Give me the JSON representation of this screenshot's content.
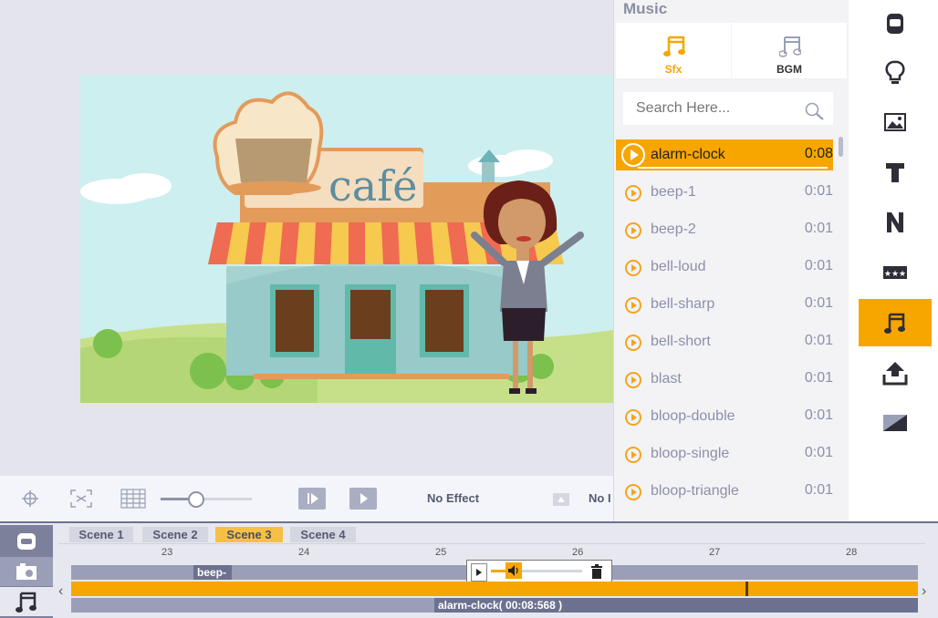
{
  "music_panel": {
    "title": "Music",
    "tabs": [
      {
        "label": "Sfx",
        "icon": "music-note-icon",
        "active": true
      },
      {
        "label": "BGM",
        "icon": "music-note-icon",
        "active": false
      }
    ],
    "search_placeholder": "Search Here...",
    "tracks": [
      {
        "name": "alarm-clock",
        "duration": "0:08",
        "selected": true
      },
      {
        "name": "beep-1",
        "duration": "0:01"
      },
      {
        "name": "beep-2",
        "duration": "0:01"
      },
      {
        "name": "bell-loud",
        "duration": "0:01"
      },
      {
        "name": "bell-sharp",
        "duration": "0:01"
      },
      {
        "name": "bell-short",
        "duration": "0:01"
      },
      {
        "name": "blast",
        "duration": "0:01"
      },
      {
        "name": "bloop-double",
        "duration": "0:01"
      },
      {
        "name": "bloop-single",
        "duration": "0:01"
      },
      {
        "name": "bloop-triangle",
        "duration": "0:01"
      }
    ]
  },
  "canvas": {
    "sign_text": "café"
  },
  "toolbar": {
    "effect_label": "No Effect",
    "second_effect_label": "No I",
    "zoom_level": 0.2
  },
  "sidebar": {
    "items": [
      "character-icon",
      "idea-bulb-icon",
      "image-icon",
      "text-icon",
      "n-icon",
      "stars-badge-icon",
      "music-icon",
      "upload-icon",
      "background-icon"
    ],
    "active": "music-icon"
  },
  "timeline": {
    "scenes": [
      "Scene 1",
      "Scene 2",
      "Scene 3",
      "Scene 4"
    ],
    "active_scene": "Scene 3",
    "ticks": [
      "23",
      "24",
      "25",
      "26",
      "27",
      "28"
    ],
    "clips": {
      "beep": "beep-",
      "alarm": "alarm-clock( 00:08:568 )"
    },
    "prev_arrow": "‹",
    "next_arrow": "›"
  },
  "colors": {
    "accent": "#f7a600",
    "panel_bg": "#f3f3f6",
    "timeline_dark": "#7c809b"
  }
}
